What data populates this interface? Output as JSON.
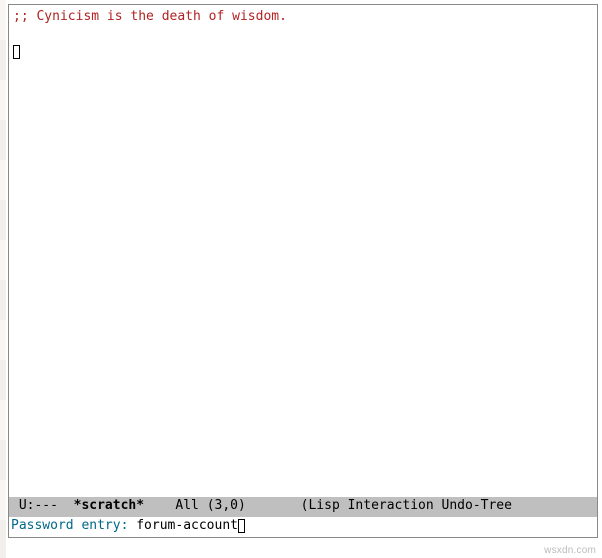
{
  "buffer": {
    "comment_line": ";; Cynicism is the death of wisdom."
  },
  "mode_line": {
    "flags": " U:---  ",
    "buffer_name": "*scratch*",
    "spacer1": "    ",
    "position": "All",
    "coords": "(3,0)",
    "spacer2": "       ",
    "modes": "(Lisp Interaction Undo-Tree"
  },
  "minibuffer": {
    "prompt": "Password entry: ",
    "input": "forum-account"
  },
  "watermark": "wsxdn.com"
}
